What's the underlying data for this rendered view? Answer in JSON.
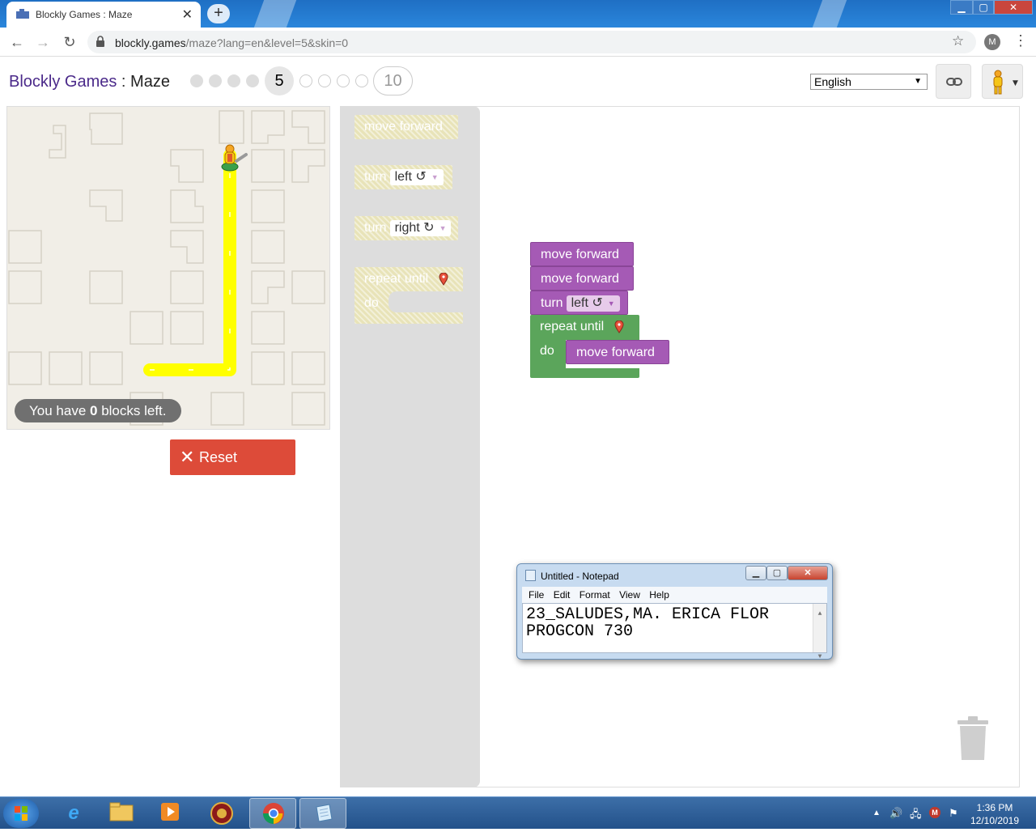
{
  "browser": {
    "tab_title": "Blockly Games : Maze",
    "tab_close": "✕",
    "new_tab": "+",
    "url_host": "blockly.games",
    "url_path": "/maze?lang=en&level=5&skin=0",
    "profile_initial": "M",
    "window_min": "▁",
    "window_max": "▢",
    "window_close": "✕"
  },
  "header": {
    "games": "Blockly Games",
    "separator": " : ",
    "maze": "Maze",
    "current_level": "5",
    "last_level": "10",
    "levels_done": 4,
    "levels_todo": 4,
    "language": "English"
  },
  "maze": {
    "blocks_left_prefix": "You have ",
    "blocks_left_count": "0",
    "blocks_left_suffix": " blocks left.",
    "reset_label": "Reset",
    "reset_icon": "✕"
  },
  "toolbox": {
    "move_forward": "move forward",
    "turn": "turn",
    "left": "left ↺",
    "right": "right ↻",
    "repeat_until": "repeat until",
    "do": "do"
  },
  "program": {
    "b1": "move forward",
    "b2": "move forward",
    "b3_turn": "turn",
    "b3_dir": "left ↺",
    "b4_repeat": "repeat until",
    "b4_do": "do",
    "b5": "move forward"
  },
  "notepad": {
    "title": "Untitled - Notepad",
    "menu": [
      "File",
      "Edit",
      "Format",
      "View",
      "Help"
    ],
    "line1": "23_SALUDES,MA. ERICA FLOR",
    "line2": "PROGCON 730"
  },
  "taskbar": {
    "time": "1:36 PM",
    "date": "12/10/2019"
  },
  "colors": {
    "purple_block": "#a55ab5",
    "green_block": "#5ba55b",
    "reset_red": "#dd4b39",
    "path_yellow": "#ffff00"
  }
}
